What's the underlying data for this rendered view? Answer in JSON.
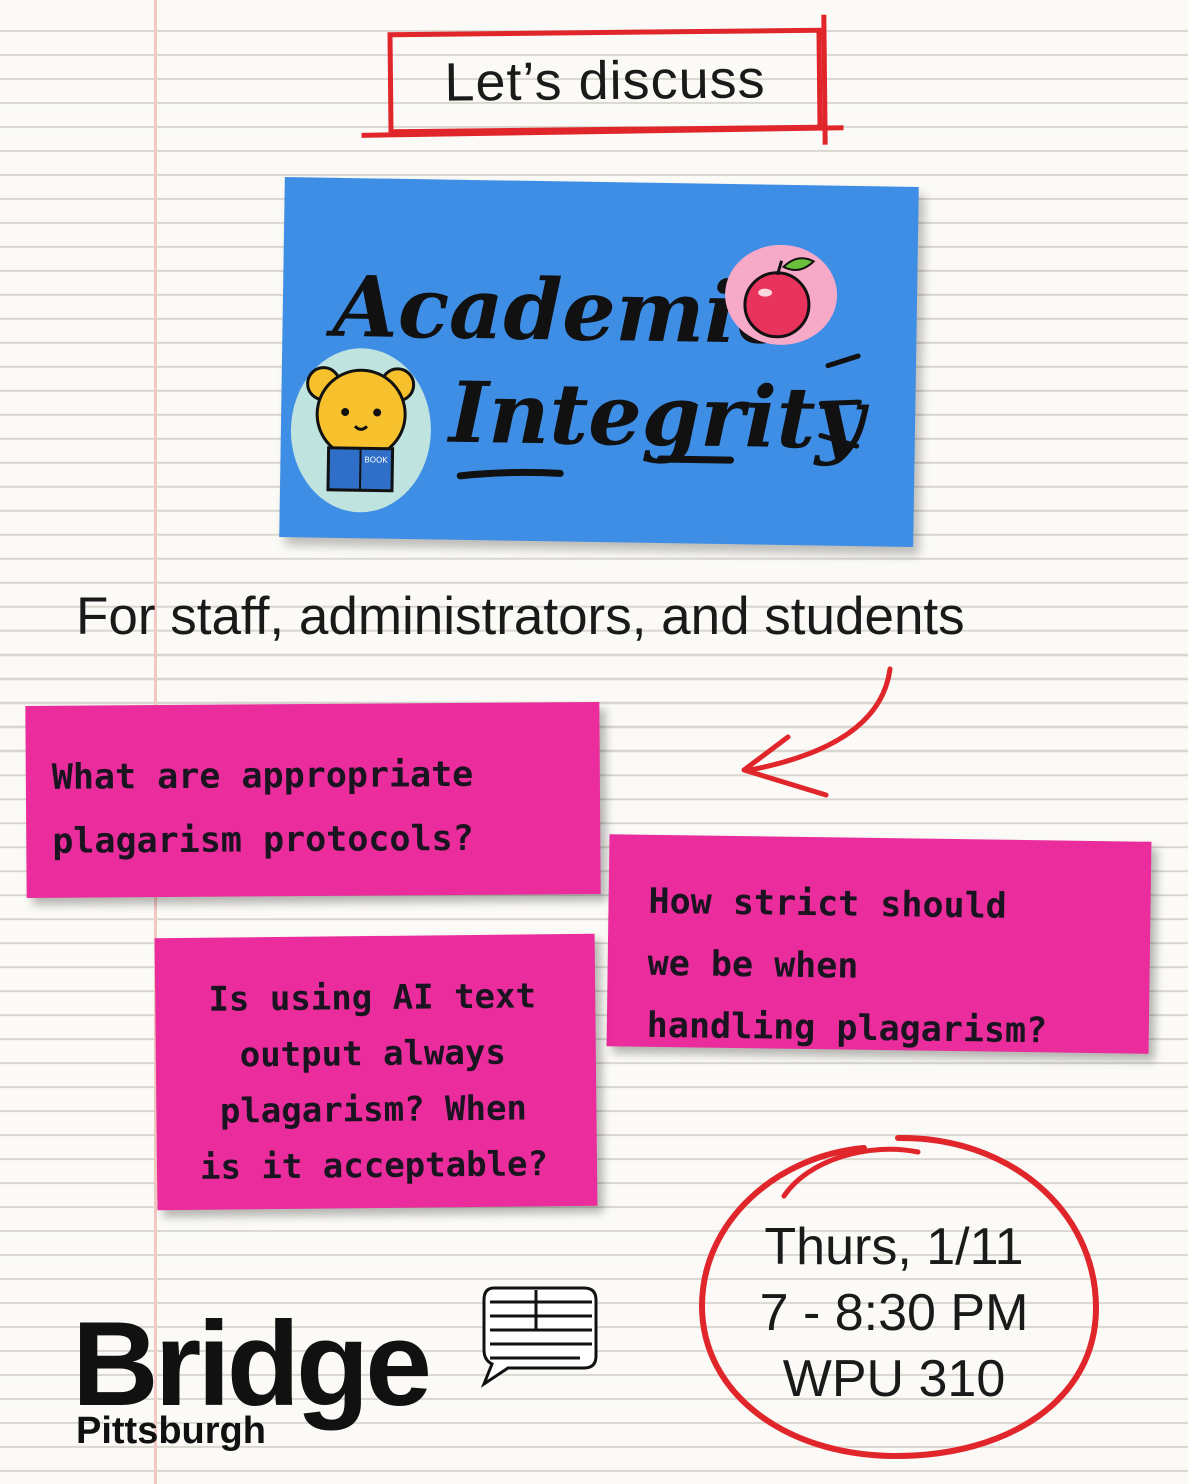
{
  "header": {
    "label": "Let’s discuss"
  },
  "title": {
    "line1": "Academic",
    "line2": "Integrity",
    "book_label": "BOOK"
  },
  "audience": "For staff, administrators, and students",
  "questions": [
    {
      "lines": [
        "What are appropriate",
        "plagarism protocols?"
      ]
    },
    {
      "lines": [
        "How strict should",
        "we be when",
        "handling plagarism?"
      ]
    },
    {
      "lines": [
        "Is using AI text",
        "output always",
        "plagarism? When",
        "is it acceptable?"
      ]
    }
  ],
  "event": {
    "date": "Thurs, 1/11",
    "time": "7 - 8:30 PM",
    "location": "WPU 310"
  },
  "brand": {
    "name": "Bridge",
    "city": "Pittsburgh"
  },
  "colors": {
    "accent_red": "#e0262a",
    "note_blue": "#3e8ee6",
    "note_pink": "#ea2c9c"
  },
  "icons": [
    "apple-sticker-icon",
    "bear-reading-sticker-icon",
    "arrow-icon",
    "speech-bubble-icon"
  ]
}
